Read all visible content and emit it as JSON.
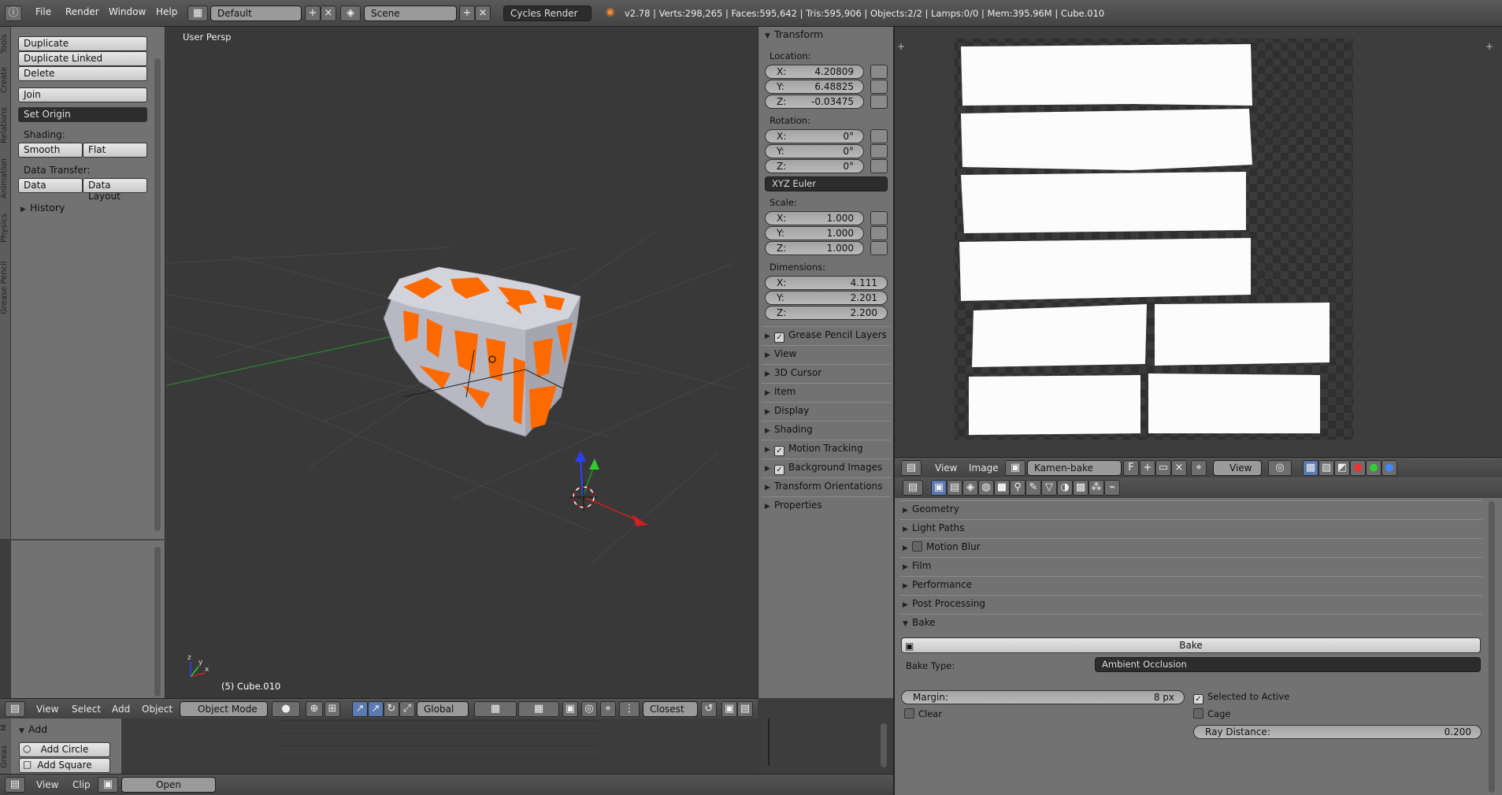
{
  "topbar": {
    "menus": [
      "File",
      "Render",
      "Window",
      "Help"
    ],
    "screen_layout": "Default",
    "scene": "Scene",
    "render_engine": "Cycles Render",
    "stats": "v2.78 | Verts:298,265 | Faces:595,642 | Tris:595,906 | Objects:2/2 | Lamps:0/0 | Mem:395.96M | Cube.010"
  },
  "left_tabs": [
    "Tools",
    "Create",
    "Relations",
    "Animation",
    "Physics",
    "Grease Pencil"
  ],
  "tool_shelf": {
    "duplicate": "Duplicate",
    "duplicate_linked": "Duplicate Linked",
    "delete": "Delete",
    "join": "Join",
    "set_origin": "Set Origin",
    "shading_label": "Shading:",
    "smooth": "Smooth",
    "flat": "Flat",
    "data_transfer_label": "Data Transfer:",
    "data": "Data",
    "data_layout": "Data Layout",
    "history": "History"
  },
  "viewport": {
    "view_label": "User Persp",
    "object_label": "(5) Cube.010"
  },
  "bottom_left": {
    "tabs": [
      "M",
      "Greas"
    ],
    "add_header": "Add",
    "add_circle": "Add Circle",
    "add_square": "Add Square"
  },
  "viewport_header": {
    "menus": [
      "View",
      "Select",
      "Add",
      "Object"
    ],
    "mode": "Object Mode",
    "orientation": "Global",
    "snap": "Closest"
  },
  "clip_header": {
    "menus": [
      "View",
      "Clip"
    ],
    "open": "Open"
  },
  "transform": {
    "title": "Transform",
    "location_label": "Location:",
    "location": [
      {
        "axis": "X:",
        "value": "4.20809"
      },
      {
        "axis": "Y:",
        "value": "6.48825"
      },
      {
        "axis": "Z:",
        "value": "-0.03475"
      }
    ],
    "rotation_label": "Rotation:",
    "rotation": [
      {
        "axis": "X:",
        "value": "0°"
      },
      {
        "axis": "Y:",
        "value": "0°"
      },
      {
        "axis": "Z:",
        "value": "0°"
      }
    ],
    "rotation_mode": "XYZ Euler",
    "scale_label": "Scale:",
    "scale": [
      {
        "axis": "X:",
        "value": "1.000"
      },
      {
        "axis": "Y:",
        "value": "1.000"
      },
      {
        "axis": "Z:",
        "value": "1.000"
      }
    ],
    "dimensions_label": "Dimensions:",
    "dimensions": [
      {
        "axis": "X:",
        "value": "4.111"
      },
      {
        "axis": "Y:",
        "value": "2.201"
      },
      {
        "axis": "Z:",
        "value": "2.200"
      }
    ]
  },
  "n_sections": [
    {
      "label": "Grease Pencil Layers",
      "checkbox": true
    },
    {
      "label": "View",
      "checkbox": false
    },
    {
      "label": "3D Cursor",
      "checkbox": false
    },
    {
      "label": "Item",
      "checkbox": false
    },
    {
      "label": "Display",
      "checkbox": false
    },
    {
      "label": "Shading",
      "checkbox": false
    },
    {
      "label": "Motion Tracking",
      "checkbox": true
    },
    {
      "label": "Background Images",
      "checkbox": true
    },
    {
      "label": "Transform Orientations",
      "checkbox": false
    },
    {
      "label": "Properties",
      "checkbox": false
    }
  ],
  "image_header": {
    "menus": [
      "View",
      "Image"
    ],
    "image_name": "Kamen-bake",
    "fake_user": "F",
    "view_mode": "View"
  },
  "render_sections": [
    {
      "label": "Geometry",
      "checkbox": false
    },
    {
      "label": "Light Paths",
      "checkbox": false
    },
    {
      "label": "Motion Blur",
      "checkbox": true
    },
    {
      "label": "Film",
      "checkbox": false
    },
    {
      "label": "Performance",
      "checkbox": false
    },
    {
      "label": "Post Processing",
      "checkbox": false
    }
  ],
  "bake": {
    "title": "Bake",
    "button": "Bake",
    "type_label": "Bake Type:",
    "type_value": "Ambient Occlusion",
    "margin_label": "Margin:",
    "margin_value": "8 px",
    "selected_to_active": "Selected to Active",
    "clear": "Clear",
    "cage": "Cage",
    "ray_distance_label": "Ray Distance:",
    "ray_distance_value": "0.200"
  },
  "colors": {
    "orange": "#ff6a00",
    "panel": "#727272",
    "viewport_bg": "#393939",
    "header": "#4a4a4a"
  }
}
